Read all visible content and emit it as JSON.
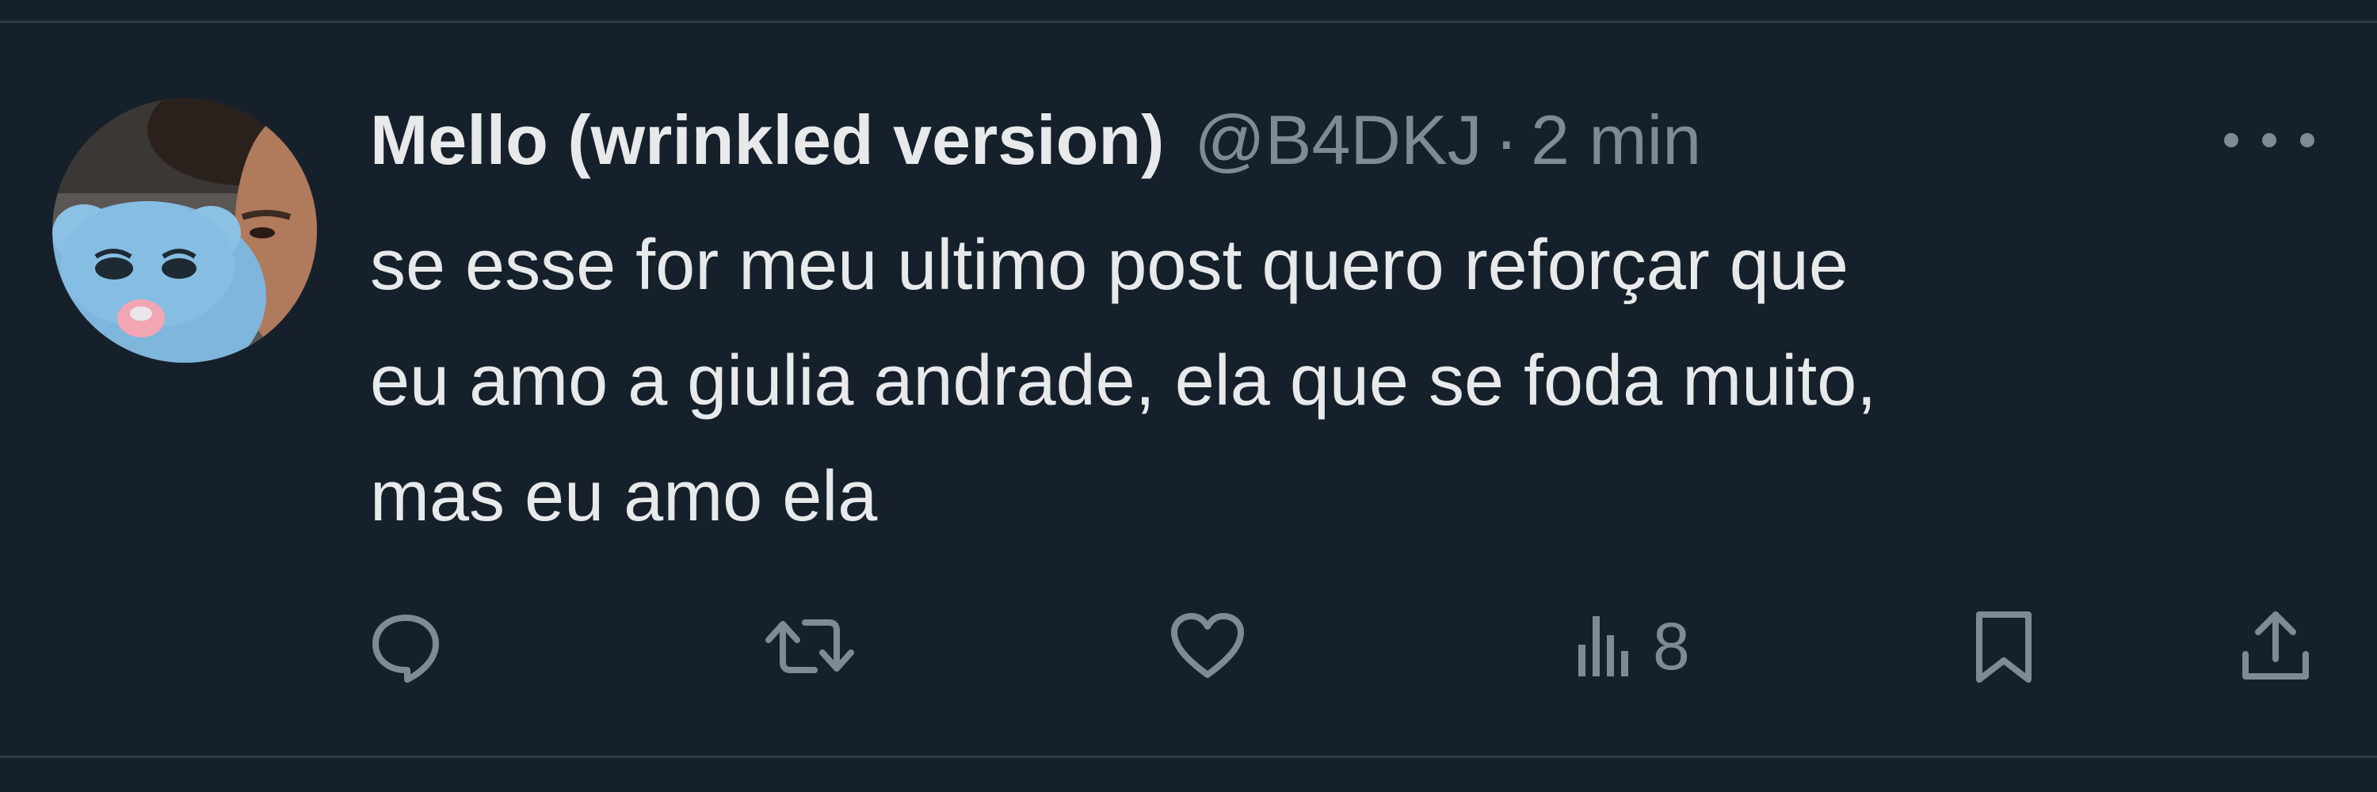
{
  "tweet": {
    "author": {
      "display_name": "Mello (wrinkled version)",
      "handle": "@B4DKJ"
    },
    "separator": "·",
    "time": "2 min",
    "text_lines": [
      "se esse for meu ultimo post quero reforçar que",
      "eu amo a giulia andrade, ela que se foda muito,",
      "mas eu amo ela"
    ],
    "actions": {
      "views_count": "8"
    }
  },
  "icons": {
    "more": "more-horizontal-icon",
    "reply": "reply-icon",
    "retweet": "retweet-icon",
    "like": "heart-icon",
    "views": "views-bar-icon",
    "bookmark": "bookmark-icon",
    "share": "share-icon"
  },
  "colors": {
    "background": "#16202b",
    "text_primary": "#e7e9ea",
    "text_secondary": "#7f8a96",
    "divider": "#2f3a45"
  }
}
